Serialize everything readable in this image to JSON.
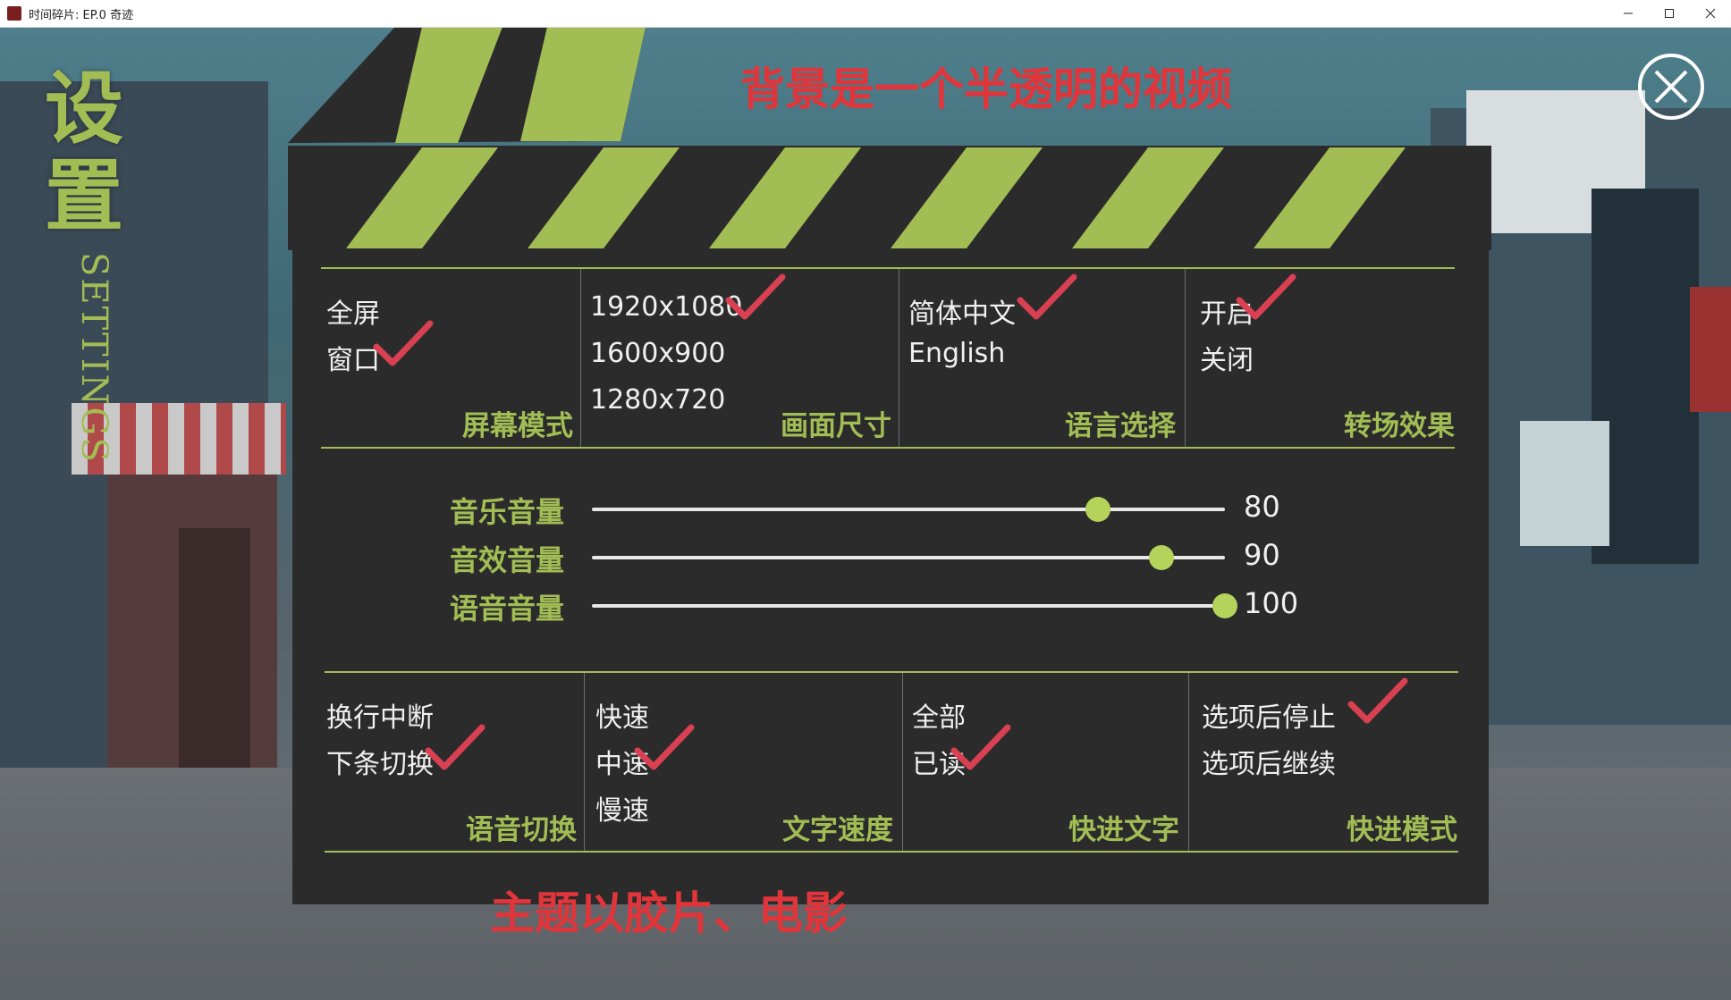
{
  "window": {
    "title": "时间碎片: EP.0 奇迹",
    "controls": [
      "minimize-icon",
      "maximize-icon",
      "close-icon"
    ]
  },
  "side_title": {
    "cn": "设置",
    "en": "SETTINGS"
  },
  "annotations": {
    "top": "背景是一个半透明的视频",
    "bottom": "主题以胶片、电影"
  },
  "colors": {
    "accent": "#a3bd55",
    "panel": "#2b2b2b",
    "check": "#d94052",
    "annotation": "#e0353a"
  },
  "top_groups": [
    {
      "category": "屏幕模式",
      "options": [
        "全屏",
        "窗口"
      ],
      "selected": 1
    },
    {
      "category": "画面尺寸",
      "options": [
        "1920x1080",
        "1600x900",
        "1280x720"
      ],
      "selected": 0
    },
    {
      "category": "语言选择",
      "options": [
        "简体中文",
        "English"
      ],
      "selected": 0
    },
    {
      "category": "转场效果",
      "options": [
        "开启",
        "关闭"
      ],
      "selected": 0
    }
  ],
  "sliders": [
    {
      "label": "音乐音量",
      "value": 80
    },
    {
      "label": "音效音量",
      "value": 90
    },
    {
      "label": "语音音量",
      "value": 100
    }
  ],
  "bottom_groups": [
    {
      "category": "语音切换",
      "options": [
        "换行中断",
        "下条切换"
      ],
      "selected": 1
    },
    {
      "category": "文字速度",
      "options": [
        "快速",
        "中速",
        "慢速"
      ],
      "selected": 1
    },
    {
      "category": "快进文字",
      "options": [
        "全部",
        "已读"
      ],
      "selected": 1
    },
    {
      "category": "快进模式",
      "options": [
        "选项后停止",
        "选项后继续"
      ],
      "selected": 0
    }
  ]
}
